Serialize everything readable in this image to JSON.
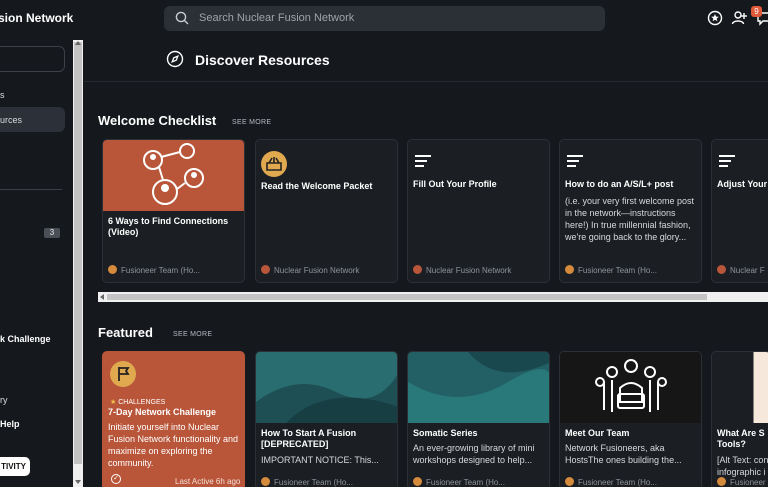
{
  "header": {
    "brand": "sion Network",
    "search_placeholder": "Search Nuclear Fusion Network",
    "notification_count": "9"
  },
  "sidebar": {
    "items": [
      {
        "label": "s"
      },
      {
        "label": "urces"
      },
      {
        "label": "3"
      },
      {
        "label": "k Challenge"
      },
      {
        "label": "ry"
      },
      {
        "label": "Help"
      },
      {
        "label": "TIVITY"
      }
    ]
  },
  "page": {
    "title": "Discover Resources"
  },
  "welcome": {
    "title": "Welcome Checklist",
    "see_more": "SEE MORE",
    "cards": [
      {
        "title": "6 Ways to Find Connections (Video)",
        "footer": "Fusioneer Team (Ho..."
      },
      {
        "title": "Read the Welcome Packet",
        "footer": "Nuclear Fusion Network"
      },
      {
        "title": "Fill Out Your Profile",
        "footer": "Nuclear Fusion Network"
      },
      {
        "title": "How to do an A/S/L+ post",
        "desc": "(i.e. your very first welcome post in the network—instructions here!) In true millennial fashion, we're going back to the glory...",
        "footer": "Fusioneer Team (Ho..."
      },
      {
        "title": "Adjust Your",
        "footer": "Nuclear F"
      }
    ]
  },
  "featured": {
    "title": "Featured",
    "see_more": "SEE MORE",
    "cards": [
      {
        "tag": "CHALLENGES",
        "title": "7-Day Network Challenge",
        "desc": "Initiate yourself into Nuclear Fusion Network functionality and maximize on exploring the community.",
        "footer": "Last Active 6h ago"
      },
      {
        "title": "How To Start A Fusion [DEPRECATED]",
        "desc": "IMPORTANT NOTICE: This...",
        "footer": "Fusioneer Team (Ho..."
      },
      {
        "title": "Somatic Series",
        "desc": "An ever-growing library of mini workshops designed to help...",
        "footer": "Fusioneer Team (Ho..."
      },
      {
        "title": "Meet Our Team",
        "desc": "Network Fusioneers, aka HostsThe ones building the...",
        "footer": "Fusioneer Team (Ho..."
      },
      {
        "title": "What Are S Tools?",
        "desc": "[Alt Text: con infographic i",
        "footer": "Fusioneer"
      }
    ]
  },
  "colors": {
    "accent_orange": "#b9563a",
    "background": "#15181d",
    "card": "#1b1f24",
    "badge": "#e05a3a"
  }
}
